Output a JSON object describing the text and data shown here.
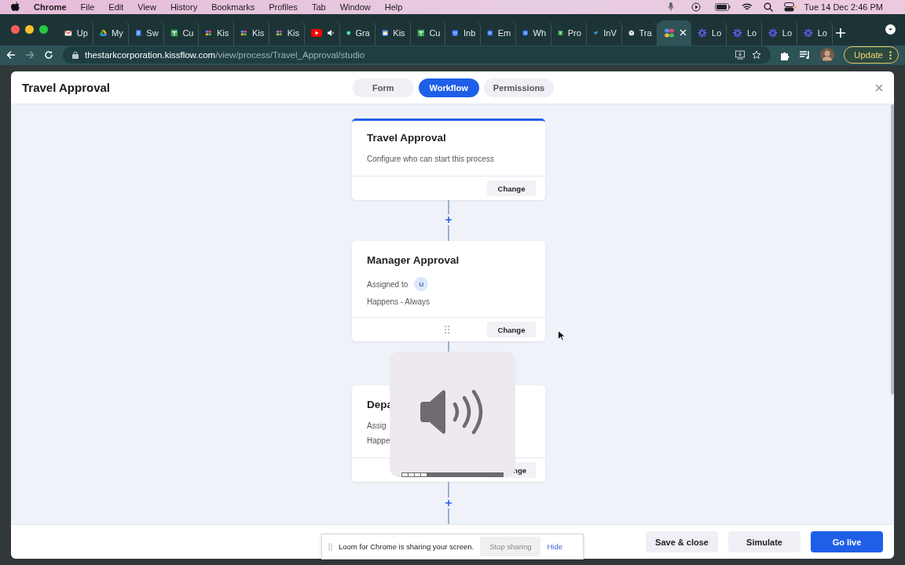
{
  "menu_bar": {
    "app": "Chrome",
    "items": [
      "File",
      "Edit",
      "View",
      "History",
      "Bookmarks",
      "Profiles",
      "Tab",
      "Window",
      "Help"
    ],
    "clock": "Tue 14 Dec  2:46 PM"
  },
  "browser": {
    "tabs": [
      {
        "kind": "gmail",
        "label": "Up",
        "selected": false
      },
      {
        "kind": "drive",
        "label": "My",
        "selected": false
      },
      {
        "kind": "docs",
        "label": "Sw",
        "selected": false
      },
      {
        "kind": "sheets",
        "label": "Cu",
        "selected": false
      },
      {
        "kind": "kissflow",
        "label": "Kis",
        "selected": false
      },
      {
        "kind": "kissflow",
        "label": "Kis",
        "selected": false
      },
      {
        "kind": "kissflow",
        "label": "Kis",
        "selected": false
      },
      {
        "kind": "youtube",
        "audio": true,
        "selected": false
      },
      {
        "kind": "grammarly",
        "label": "Gra",
        "selected": false
      },
      {
        "kind": "calendar",
        "label": "Kis",
        "selected": false
      },
      {
        "kind": "sheets",
        "label": "Cu",
        "selected": false
      },
      {
        "kind": "intercom",
        "label": "Inb",
        "selected": false
      },
      {
        "kind": "intercom",
        "label": "Em",
        "selected": false
      },
      {
        "kind": "intercom",
        "label": "Wh",
        "selected": false
      },
      {
        "kind": "sheets",
        "label": "Pro",
        "selected": false
      },
      {
        "kind": "twitter",
        "label": "InV",
        "selected": false
      },
      {
        "kind": "globe",
        "label": "Tra",
        "selected": false
      },
      {
        "kind": "kissflow",
        "selected": true
      },
      {
        "kind": "loom",
        "label": "Lo",
        "selected": false
      },
      {
        "kind": "loom",
        "label": "Lo",
        "selected": false
      },
      {
        "kind": "loom",
        "label": "Lo",
        "selected": false
      },
      {
        "kind": "loom",
        "label": "Lo",
        "selected": false
      }
    ],
    "url": {
      "host": "thestarkcorporation.kissflow.com",
      "path": "/view/process/Travel_Approval/studio"
    },
    "update_button": "Update"
  },
  "app": {
    "title": "Travel Approval",
    "tabs": [
      {
        "label": "Form",
        "selected": false
      },
      {
        "label": "Workflow",
        "selected": true
      },
      {
        "label": "Permissions",
        "selected": false
      }
    ],
    "cards": [
      {
        "kind": "start",
        "title": "Travel Approval",
        "description": "Configure who can start this process",
        "button": "Change"
      },
      {
        "kind": "step",
        "title": "Manager Approval",
        "assigned_label": "Assigned to",
        "assignee": "U",
        "condition": "Happens - Always",
        "button": "Change"
      },
      {
        "kind": "step",
        "title": "Depa",
        "assigned_label": "Assig",
        "condition": "Happe",
        "button": "nge"
      }
    ],
    "footer_buttons": [
      {
        "label": "Save & close",
        "kind": "secondary"
      },
      {
        "label": "Simulate",
        "kind": "secondary"
      },
      {
        "label": "Go live",
        "kind": "primary"
      }
    ]
  },
  "loom_bar": {
    "message": "Loom for Chrome is sharing your screen.",
    "stop": "Stop sharing",
    "hide": "Hide"
  },
  "volume_overlay": {
    "level": 0.25
  }
}
